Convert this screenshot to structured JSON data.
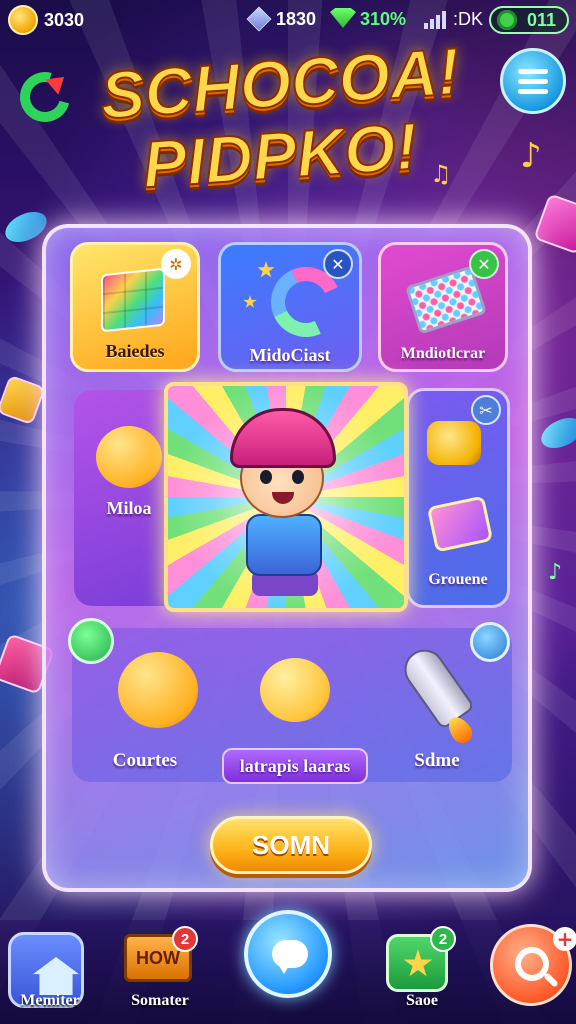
{
  "status": {
    "coins": "3030",
    "gems": "1830",
    "wifi_value": "310%",
    "signal_value": ":DK",
    "battery_value": "011"
  },
  "title": {
    "line1": "SCHOCOA!",
    "line2": "PIDPKO!"
  },
  "tiles": {
    "blocks": "Baiedes",
    "mido": "MidoCiast",
    "melodic": "Mndiotlcrar",
    "miloa": "Miloa",
    "grouene": "Grouene"
  },
  "items": {
    "courtes": "Courtes",
    "latrapis": "latrapis laaras",
    "sdme": "Sdme"
  },
  "main_button": "SOMN",
  "nav": {
    "home": "Memiter",
    "how_sign": "HOW",
    "how_badge": "2",
    "how_label": "Somater",
    "stars_badge": "2",
    "stars_label": "Saoe"
  },
  "colors": {
    "accent": "#ffb31a",
    "title": "#ffd84a",
    "panel_border": "#fff0ff"
  }
}
